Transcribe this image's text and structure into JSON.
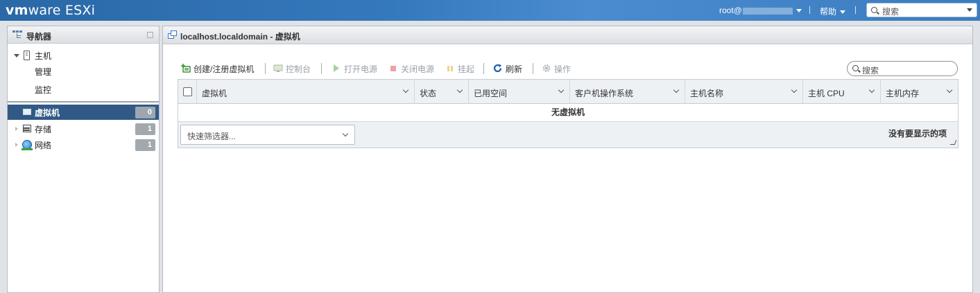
{
  "topbar": {
    "brand_vm": "vm",
    "brand_ware": "ware",
    "brand_product": " ESXi",
    "user_prefix": "root@",
    "help_label": "帮助",
    "search_placeholder": "搜索"
  },
  "navigator": {
    "title": "导航器",
    "host_label": "主机",
    "manage_label": "管理",
    "monitor_label": "监控",
    "items": [
      {
        "label": "虚拟机",
        "count": "0"
      },
      {
        "label": "存储",
        "count": "1"
      },
      {
        "label": "网络",
        "count": "1"
      }
    ]
  },
  "main": {
    "title": "localhost.localdomain - 虚拟机",
    "toolbar": {
      "create": "创建/注册虚拟机",
      "console": "控制台",
      "power_on": "打开电源",
      "power_off": "关闭电源",
      "suspend": "挂起",
      "refresh": "刷新",
      "actions": "操作"
    },
    "search_placeholder": "搜索",
    "columns": [
      "虚拟机",
      "状态",
      "已用空间",
      "客户机操作系统",
      "主机名称",
      "主机 CPU",
      "主机内存"
    ],
    "empty_message": "无虚拟机",
    "quick_filter": "快速筛选器...",
    "no_items": "没有要显示的项"
  },
  "colors": {
    "topbar": "#2f6fb0",
    "selected_nav": "#305a85",
    "badge": "#a3a8ad"
  }
}
